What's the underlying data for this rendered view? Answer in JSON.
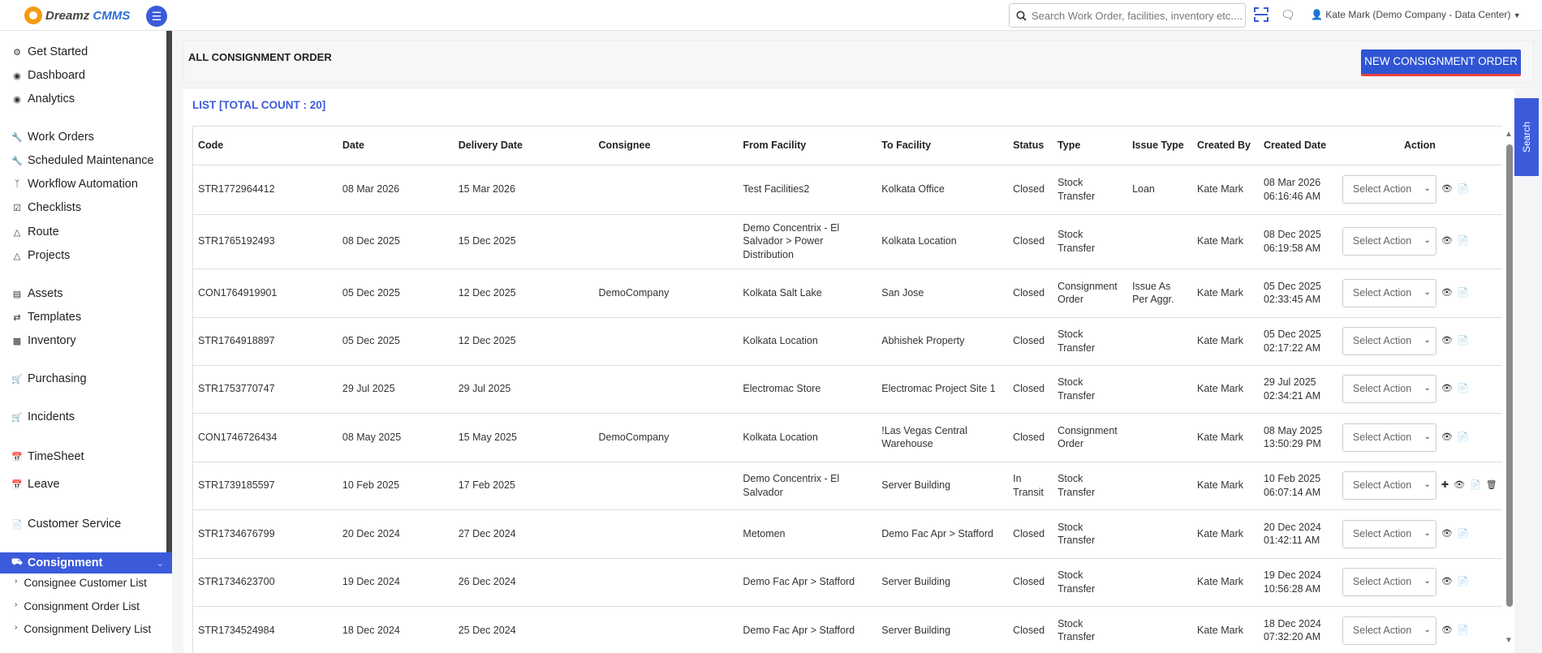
{
  "app": {
    "brand_main": "Dreamz",
    "brand_accent": "CMMS"
  },
  "topbar": {
    "search_placeholder": "Search Work Order, facilities, inventory etc....",
    "user": "Kate Mark (Demo Company - Data Center)"
  },
  "sidebar": {
    "items": [
      {
        "label": "Get Started",
        "icon": "gears-icon"
      },
      {
        "label": "Dashboard",
        "icon": "dashboard-icon"
      },
      {
        "label": "Analytics",
        "icon": "analytics-icon"
      },
      {
        "label": "Work Orders",
        "icon": "wrench-icon"
      },
      {
        "label": "Scheduled Maintenance",
        "icon": "wrench-icon"
      },
      {
        "label": "Workflow Automation",
        "icon": "workflow-icon"
      },
      {
        "label": "Checklists",
        "icon": "checkbox-icon"
      },
      {
        "label": "Route",
        "icon": "road-icon"
      },
      {
        "label": "Projects",
        "icon": "road-icon"
      },
      {
        "label": "Assets",
        "icon": "asset-icon"
      },
      {
        "label": "Templates",
        "icon": "random-icon"
      },
      {
        "label": "Inventory",
        "icon": "briefcase-icon"
      },
      {
        "label": "Purchasing",
        "icon": "cart-icon"
      },
      {
        "label": "Incidents",
        "icon": "cart-icon"
      },
      {
        "label": "TimeSheet",
        "icon": "calendar-icon"
      },
      {
        "label": "Leave",
        "icon": "calendar-icon"
      },
      {
        "label": "Customer Service",
        "icon": "file-icon"
      }
    ],
    "active": {
      "label": "Consignment",
      "icon": "truck-icon"
    },
    "sub_items": [
      "Consignee Customer List",
      "Consignment Order List",
      "Consignment Delivery List"
    ]
  },
  "main": {
    "title": "ALL CONSIGNMENT ORDER",
    "new_button": "NEW CONSIGNMENT ORDER",
    "list_title": "LIST [TOTAL COUNT : 20]",
    "search_tab": "Search",
    "columns": [
      "Code",
      "Date",
      "Delivery Date",
      "Consignee",
      "From Facility",
      "To Facility",
      "Status",
      "Type",
      "Issue Type",
      "Created By",
      "Created Date",
      "Action"
    ],
    "select_placeholder": "Select Action",
    "rows": [
      {
        "code": "STR1772964412",
        "date": "08 Mar 2026",
        "delivery": "15 Mar 2026",
        "consignee": "",
        "from": "Test Facilities2",
        "to": "Kolkata Office",
        "status": "Closed",
        "type": "Stock Transfer",
        "issue": "Loan",
        "by": "Kate Mark",
        "created": "08 Mar 2026 06:16:46 AM",
        "extra": false
      },
      {
        "code": "STR1765192493",
        "date": "08 Dec 2025",
        "delivery": "15 Dec 2025",
        "consignee": "",
        "from": "Demo Concentrix - El Salvador > Power Distribution",
        "to": "Kolkata Location",
        "status": "Closed",
        "type": "Stock Transfer",
        "issue": "",
        "by": "Kate Mark",
        "created": "08 Dec 2025 06:19:58 AM",
        "extra": false
      },
      {
        "code": "CON1764919901",
        "date": "05 Dec 2025",
        "delivery": "12 Dec 2025",
        "consignee": "DemoCompany",
        "from": "Kolkata Salt Lake",
        "to": "San Jose",
        "status": "Closed",
        "type": "Consignment Order",
        "issue": "Issue As Per Aggr.",
        "by": "Kate Mark",
        "created": "05 Dec 2025 02:33:45 AM",
        "extra": false
      },
      {
        "code": "STR1764918897",
        "date": "05 Dec 2025",
        "delivery": "12 Dec 2025",
        "consignee": "",
        "from": "Kolkata Location",
        "to": "Abhishek Property",
        "status": "Closed",
        "type": "Stock Transfer",
        "issue": "",
        "by": "Kate Mark",
        "created": "05 Dec 2025 02:17:22 AM",
        "extra": false
      },
      {
        "code": "STR1753770747",
        "date": "29 Jul 2025",
        "delivery": "29 Jul 2025",
        "consignee": "",
        "from": "Electromac Store",
        "to": "Electromac Project Site 1",
        "status": "Closed",
        "type": "Stock Transfer",
        "issue": "",
        "by": "Kate Mark",
        "created": "29 Jul 2025 02:34:21 AM",
        "extra": false
      },
      {
        "code": "CON1746726434",
        "date": "08 May 2025",
        "delivery": "15 May 2025",
        "consignee": "DemoCompany",
        "from": "Kolkata Location",
        "to": "!Las Vegas Central Warehouse",
        "status": "Closed",
        "type": "Consignment Order",
        "issue": "",
        "by": "Kate Mark",
        "created": "08 May 2025 13:50:29 PM",
        "extra": false
      },
      {
        "code": "STR1739185597",
        "date": "10 Feb 2025",
        "delivery": "17 Feb 2025",
        "consignee": "",
        "from": "Demo Concentrix - El Salvador",
        "to": "Server Building",
        "status": "In Transit",
        "type": "Stock Transfer",
        "issue": "",
        "by": "Kate Mark",
        "created": "10 Feb 2025 06:07:14 AM",
        "extra": true
      },
      {
        "code": "STR1734676799",
        "date": "20 Dec 2024",
        "delivery": "27 Dec 2024",
        "consignee": "",
        "from": "Metomen",
        "to": "Demo Fac Apr > Stafford",
        "status": "Closed",
        "type": "Stock Transfer",
        "issue": "",
        "by": "Kate Mark",
        "created": "20 Dec 2024 01:42:11 AM",
        "extra": false
      },
      {
        "code": "STR1734623700",
        "date": "19 Dec 2024",
        "delivery": "26 Dec 2024",
        "consignee": "",
        "from": "Demo Fac Apr > Stafford",
        "to": "Server Building",
        "status": "Closed",
        "type": "Stock Transfer",
        "issue": "",
        "by": "Kate Mark",
        "created": "19 Dec 2024 10:56:28 AM",
        "extra": false
      },
      {
        "code": "STR1734524984",
        "date": "18 Dec 2024",
        "delivery": "25 Dec 2024",
        "consignee": "",
        "from": "Demo Fac Apr > Stafford",
        "to": "Server Building",
        "status": "Closed",
        "type": "Stock Transfer",
        "issue": "",
        "by": "Kate Mark",
        "created": "18 Dec 2024 07:32:20 AM",
        "extra": false
      }
    ]
  },
  "colors": {
    "accent": "#3b5bdb",
    "underline": "#e84040"
  }
}
